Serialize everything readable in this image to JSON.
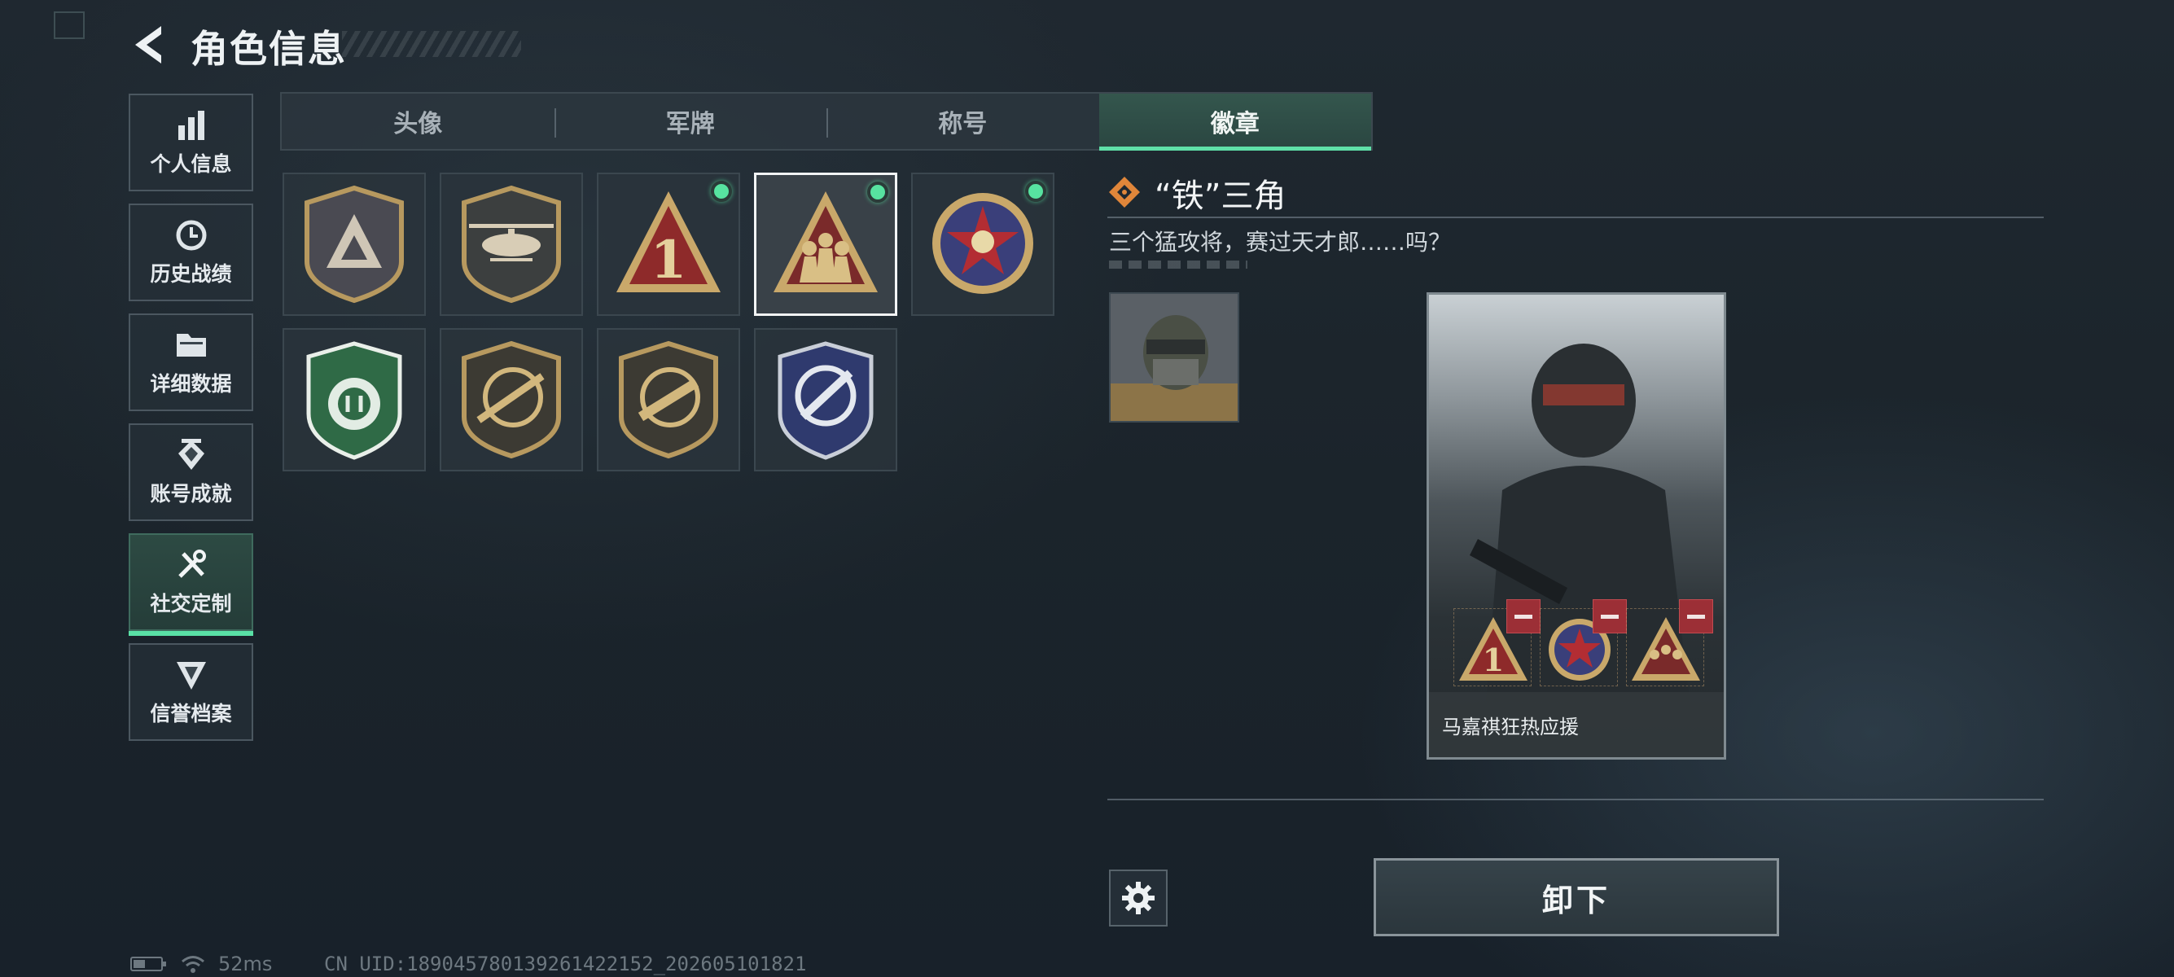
{
  "header": {
    "title": "角色信息"
  },
  "nav": [
    {
      "label": "个人信息",
      "icon": "bar-chart-icon",
      "active": false
    },
    {
      "label": "历史战绩",
      "icon": "history-clock-icon",
      "active": false
    },
    {
      "label": "详细数据",
      "icon": "folder-icon",
      "active": false
    },
    {
      "label": "账号成就",
      "icon": "achievement-badge-icon",
      "active": false
    },
    {
      "label": "社交定制",
      "icon": "tools-icon",
      "active": true
    },
    {
      "label": "信誉档案",
      "icon": "reputation-chevron-icon",
      "active": false
    }
  ],
  "tabs": [
    {
      "label": "头像",
      "active": false
    },
    {
      "label": "军牌",
      "active": false
    },
    {
      "label": "称号",
      "active": false
    },
    {
      "label": "徽章",
      "active": true
    }
  ],
  "badges": [
    {
      "icon": "triangle-emblem-badge",
      "equipped": false,
      "selected": false
    },
    {
      "icon": "helicopter-badge",
      "equipped": false,
      "selected": false
    },
    {
      "icon": "number-one-triangle-badge",
      "equipped": true,
      "selected": false
    },
    {
      "icon": "iron-triangle-squad-badge",
      "equipped": true,
      "selected": true
    },
    {
      "icon": "star-medal-badge",
      "equipped": true,
      "selected": false
    },
    {
      "icon": "green-shield-badge",
      "equipped": false,
      "selected": false
    },
    {
      "icon": "rifle-crosshair-badge",
      "equipped": false,
      "selected": false
    },
    {
      "icon": "smg-crosshair-badge",
      "equipped": false,
      "selected": false
    },
    {
      "icon": "knife-crosshair-badge",
      "equipped": false,
      "selected": false
    }
  ],
  "detail": {
    "name": "“铁”三角",
    "description": "三个猛攻将，赛过天才郎……吗？"
  },
  "card": {
    "operator_name": "马嘉祺狂热应援"
  },
  "actions": {
    "unequip": "卸下"
  },
  "status": {
    "ping": "52ms",
    "uid": "CN UID:18904578013926142215​2_202605101821"
  },
  "colors": {
    "accent": "#59e1a6",
    "remove": "#9c2f36",
    "badge_gold": "#c9a86a"
  }
}
